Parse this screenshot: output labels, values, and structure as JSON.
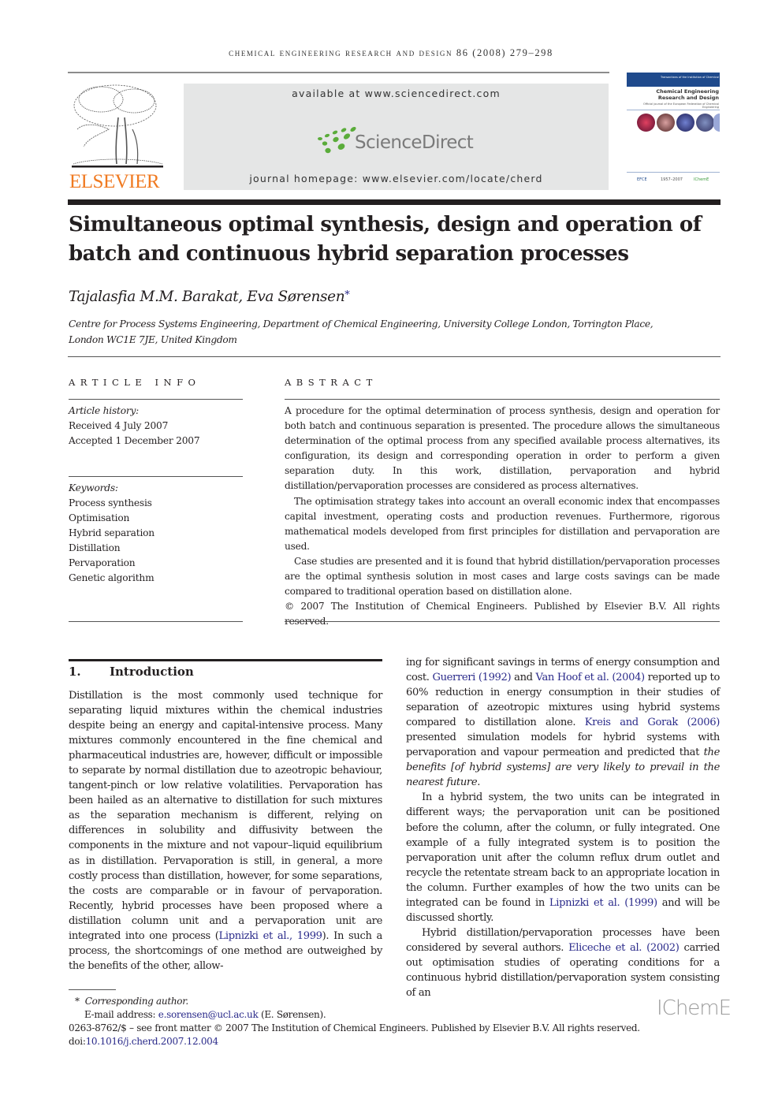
{
  "header": {
    "running_head": "chemical engineering research and design 86 (2008) 279–298",
    "banner_available": "available at www.sciencedirect.com",
    "banner_logo_text": "ScienceDirect",
    "banner_homepage": "journal homepage: www.elsevier.com/locate/cherd",
    "publisher_logo_text": "ELSEVIER",
    "cover": {
      "band_text": "Transactions of the Institution of Chemical Engineers",
      "title": "Chemical Engineering Research and Design",
      "subtitle": "Official journal of the European Federation of Chemical Engineering",
      "badges": [
        "EFCE",
        "1957–2007",
        "IChemE"
      ]
    },
    "colors": {
      "elsevier_orange": "#f07a21",
      "sciencedirect_green": "#5aac3a",
      "link_blue": "#2a2a8a",
      "banner_grey": "#e5e6e6"
    }
  },
  "article": {
    "title_line1": "Simultaneous optimal synthesis, design and operation of",
    "title_line2": "batch and continuous hybrid separation processes",
    "authors": "Tajalasfia M.M. Barakat, Eva Sørensen",
    "author_mark": "*",
    "affiliation_line1": "Centre for Process Systems Engineering, Department of Chemical Engineering, University College London, Torrington Place,",
    "affiliation_line2": "London WC1E 7JE, United Kingdom"
  },
  "article_info": {
    "heading": "ARTICLE INFO",
    "history_label": "Article history:",
    "received": "Received 4 July 2007",
    "accepted": "Accepted 1 December 2007",
    "keywords_label": "Keywords:",
    "keywords": [
      "Process synthesis",
      "Optimisation",
      "Hybrid separation",
      "Distillation",
      "Pervaporation",
      "Genetic algorithm"
    ]
  },
  "abstract": {
    "heading": "ABSTRACT",
    "p1": "A procedure for the optimal determination of process synthesis, design and operation for both batch and continuous separation is presented. The procedure allows the simultaneous determination of the optimal process from any specified available process alternatives, its configuration, its design and corresponding operation in order to perform a given separation duty. In this work, distillation, pervaporation and hybrid distillation/pervaporation processes are considered as process alternatives.",
    "p2": "The optimisation strategy takes into account an overall economic index that encompasses capital investment, operating costs and production revenues. Furthermore, rigorous mathematical models developed from first principles for distillation and pervaporation are used.",
    "p3": "Case studies are presented and it is found that hybrid distillation/pervaporation processes are the optimal synthesis solution in most cases and large costs savings can be made compared to traditional operation based on distillation alone.",
    "copyright": "© 2007 The Institution of Chemical Engineers. Published by Elsevier B.V. All rights reserved."
  },
  "intro": {
    "number": "1.",
    "heading": "Introduction",
    "left_p1_a": "Distillation is the most commonly used technique for separating liquid mixtures within the chemical industries despite being an energy and capital-intensive process. Many mixtures commonly encountered in the fine chemical and pharmaceutical industries are, however, difficult or impossible to separate by normal distillation due to azeotropic behaviour, tangent-pinch or low relative volatilities. Pervaporation has been hailed as an alternative to distillation for such mixtures as the separation mechanism is different, relying on differences in solubility and diffusivity between the components in the mixture and not vapour–liquid equilibrium as in distillation. Pervaporation is still, in general, a more costly process than distillation, however, for some separations, the costs are comparable or in favour of pervaporation. Recently, hybrid processes have been proposed where a distillation column unit and a pervaporation unit are integrated into one process (",
    "cite_lipnizki_1": "Lipnizki et al., 1999",
    "left_p1_b": "). In such a process, the shortcomings of one method are outweighed by the benefits of the other, allow-",
    "right_p1_a": "ing for significant savings in terms of energy consumption and cost. ",
    "cite_guerreri": "Guerreri (1992)",
    "right_p1_b": " and ",
    "cite_vanhoof": "Van Hoof et al. (2004)",
    "right_p1_c": " reported up to 60% reduction in energy consumption in their studies of separation of azeotropic mixtures using hybrid systems compared to distillation alone. ",
    "cite_kreis": "Kreis and Gorak (2006)",
    "right_p1_d": " presented simulation models for hybrid systems with pervaporation and vapour permeation and predicted that ",
    "right_p1_italic": "the benefits [of hybrid systems] are very likely to prevail in the nearest future",
    "right_p1_e": ".",
    "right_p2_a": "In a hybrid system, the two units can be integrated in different ways; the pervaporation unit can be positioned before the column, after the column, or fully integrated. One example of a fully integrated system is to position the pervaporation unit after the column reflux drum outlet and recycle the retentate stream back to an appropriate location in the column. Further examples of how the two units can be integrated can be found in ",
    "cite_lipnizki_2": "Lipnizki et al. (1999)",
    "right_p2_b": " and will be discussed shortly.",
    "right_p3_a": "Hybrid distillation/pervaporation processes have been considered by several authors. ",
    "cite_eliceche": "Eliceche et al. (2002)",
    "right_p3_b": " carried out optimisation studies of operating conditions for a continuous hybrid distillation/pervaporation system consisting of an"
  },
  "footer": {
    "star": "*",
    "corresponding": "Corresponding author.",
    "email_label": "E-mail address: ",
    "email": "e.sorensen@ucl.ac.uk",
    "email_suffix": " (E. Sørensen).",
    "front_matter": "0263-8762/$ – see front matter © 2007 The Institution of Chemical Engineers. Published by Elsevier B.V. All rights reserved.",
    "doi_label": "doi:",
    "doi": "10.1016/j.cherd.2007.12.004",
    "society_logo": "IChemE"
  }
}
